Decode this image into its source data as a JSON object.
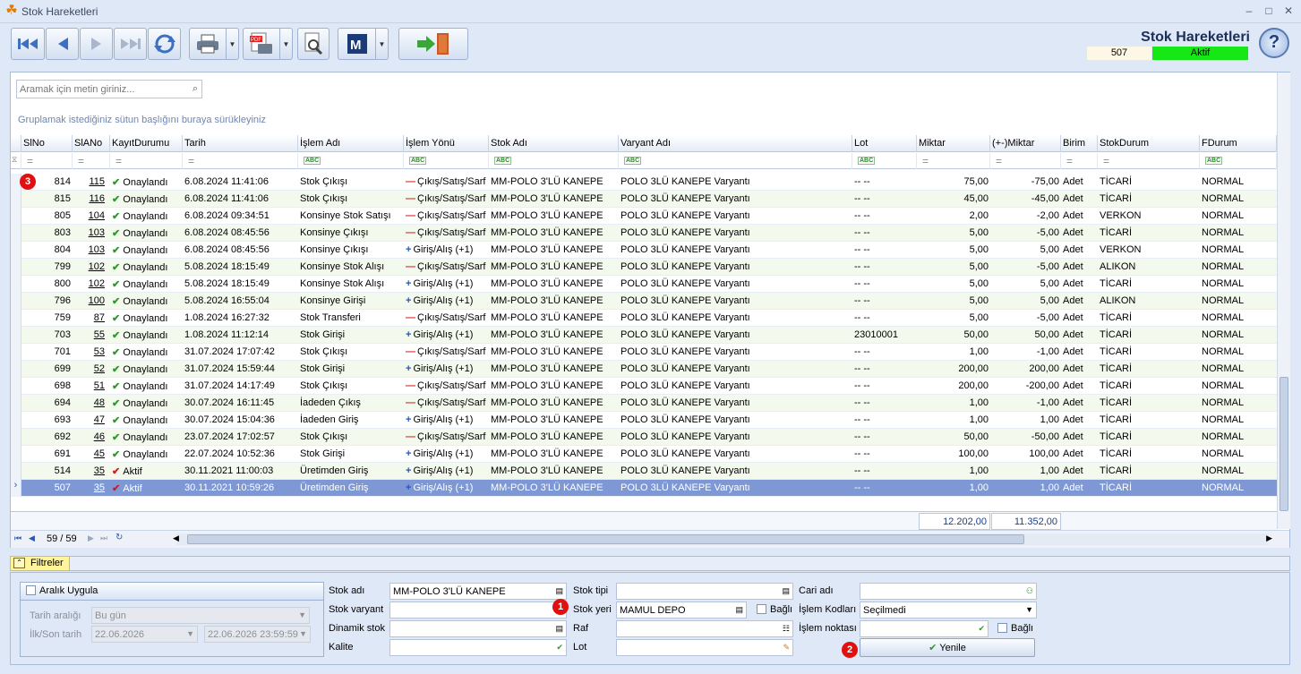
{
  "window": {
    "title": "Stok Hareketleri",
    "min": "–",
    "max": "□",
    "close": "✕"
  },
  "header": {
    "form_title": "Stok Hareketleri",
    "record_no": "507",
    "record_status": "Aktif"
  },
  "help": {
    "label": "?"
  },
  "grid": {
    "search_placeholder": "Aramak için metin giriniz...",
    "group_hint": "Gruplamak istediğiniz sütun başlığını buraya sürükleyiniz",
    "columns": [
      "SlNo",
      "SlANo",
      "KayıtDurumu",
      "Tarih",
      "İşlem Adı",
      "İşlem Yönü",
      "Stok Adı",
      "Varyant Adı",
      "Lot",
      "Miktar",
      "(+-)Miktar",
      "Birim",
      "StokDurum",
      "FDurum"
    ],
    "filter_eq": "=",
    "filter_abc": "ABC",
    "rows": [
      {
        "sl": "814",
        "sla": "115",
        "durum": "Onaylandı",
        "tarih": "6.08.2024 11:41:06",
        "islem": "Stok Çıkışı",
        "yon": "Çıkış/Satış/Sarf",
        "yonType": "minus",
        "stok": "MM-POLO 3'LÜ KANEPE",
        "varyant": "POLO 3LÜ KANEPE Varyantı",
        "lot": "-- --",
        "miktar": "75,00",
        "pm": "-75,00",
        "birim": "Adet",
        "sd": "TİCARİ",
        "fd": "NORMAL",
        "ok": true
      },
      {
        "sl": "815",
        "sla": "116",
        "durum": "Onaylandı",
        "tarih": "6.08.2024 11:41:06",
        "islem": "Stok Çıkışı",
        "yon": "Çıkış/Satış/Sarf",
        "yonType": "minus",
        "stok": "MM-POLO 3'LÜ KANEPE",
        "varyant": "POLO 3LÜ KANEPE Varyantı",
        "lot": "-- --",
        "miktar": "45,00",
        "pm": "-45,00",
        "birim": "Adet",
        "sd": "TİCARİ",
        "fd": "NORMAL",
        "ok": true
      },
      {
        "sl": "805",
        "sla": "104",
        "durum": "Onaylandı",
        "tarih": "6.08.2024 09:34:51",
        "islem": "Konsinye Stok Satışı",
        "yon": "Çıkış/Satış/Sarf",
        "yonType": "minus",
        "stok": "MM-POLO 3'LÜ KANEPE",
        "varyant": "POLO 3LÜ KANEPE Varyantı",
        "lot": "-- --",
        "miktar": "2,00",
        "pm": "-2,00",
        "birim": "Adet",
        "sd": "VERKON",
        "fd": "NORMAL",
        "ok": true
      },
      {
        "sl": "803",
        "sla": "103",
        "durum": "Onaylandı",
        "tarih": "6.08.2024 08:45:56",
        "islem": "Konsinye Çıkışı",
        "yon": "Çıkış/Satış/Sarf",
        "yonType": "minus",
        "stok": "MM-POLO 3'LÜ KANEPE",
        "varyant": "POLO 3LÜ KANEPE Varyantı",
        "lot": "-- --",
        "miktar": "5,00",
        "pm": "-5,00",
        "birim": "Adet",
        "sd": "TİCARİ",
        "fd": "NORMAL",
        "ok": true
      },
      {
        "sl": "804",
        "sla": "103",
        "durum": "Onaylandı",
        "tarih": "6.08.2024 08:45:56",
        "islem": "Konsinye Çıkışı",
        "yon": "Giriş/Alış (+1)",
        "yonType": "plus",
        "stok": "MM-POLO 3'LÜ KANEPE",
        "varyant": "POLO 3LÜ KANEPE Varyantı",
        "lot": "-- --",
        "miktar": "5,00",
        "pm": "5,00",
        "birim": "Adet",
        "sd": "VERKON",
        "fd": "NORMAL",
        "ok": true
      },
      {
        "sl": "799",
        "sla": "102",
        "durum": "Onaylandı",
        "tarih": "5.08.2024 18:15:49",
        "islem": "Konsinye Stok Alışı",
        "yon": "Çıkış/Satış/Sarf",
        "yonType": "minus",
        "stok": "MM-POLO 3'LÜ KANEPE",
        "varyant": "POLO 3LÜ KANEPE Varyantı",
        "lot": "-- --",
        "miktar": "5,00",
        "pm": "-5,00",
        "birim": "Adet",
        "sd": "ALIKON",
        "fd": "NORMAL",
        "ok": true
      },
      {
        "sl": "800",
        "sla": "102",
        "durum": "Onaylandı",
        "tarih": "5.08.2024 18:15:49",
        "islem": "Konsinye Stok Alışı",
        "yon": "Giriş/Alış (+1)",
        "yonType": "plus",
        "stok": "MM-POLO 3'LÜ KANEPE",
        "varyant": "POLO 3LÜ KANEPE Varyantı",
        "lot": "-- --",
        "miktar": "5,00",
        "pm": "5,00",
        "birim": "Adet",
        "sd": "TİCARİ",
        "fd": "NORMAL",
        "ok": true
      },
      {
        "sl": "796",
        "sla": "100",
        "durum": "Onaylandı",
        "tarih": "5.08.2024 16:55:04",
        "islem": "Konsinye Girişi",
        "yon": "Giriş/Alış (+1)",
        "yonType": "plus",
        "stok": "MM-POLO 3'LÜ KANEPE",
        "varyant": "POLO 3LÜ KANEPE Varyantı",
        "lot": "-- --",
        "miktar": "5,00",
        "pm": "5,00",
        "birim": "Adet",
        "sd": "ALIKON",
        "fd": "NORMAL",
        "ok": true
      },
      {
        "sl": "759",
        "sla": "87",
        "durum": "Onaylandı",
        "tarih": "1.08.2024 16:27:32",
        "islem": "Stok Transferi",
        "yon": "Çıkış/Satış/Sarf",
        "yonType": "minus",
        "stok": "MM-POLO 3'LÜ KANEPE",
        "varyant": "POLO 3LÜ KANEPE Varyantı",
        "lot": "-- --",
        "miktar": "5,00",
        "pm": "-5,00",
        "birim": "Adet",
        "sd": "TİCARİ",
        "fd": "NORMAL",
        "ok": true
      },
      {
        "sl": "703",
        "sla": "55",
        "durum": "Onaylandı",
        "tarih": "1.08.2024 11:12:14",
        "islem": "Stok Girişi",
        "yon": "Giriş/Alış (+1)",
        "yonType": "plus",
        "stok": "MM-POLO 3'LÜ KANEPE",
        "varyant": "POLO 3LÜ KANEPE Varyantı",
        "lot": "23010001",
        "miktar": "50,00",
        "pm": "50,00",
        "birim": "Adet",
        "sd": "TİCARİ",
        "fd": "NORMAL",
        "ok": true
      },
      {
        "sl": "701",
        "sla": "53",
        "durum": "Onaylandı",
        "tarih": "31.07.2024 17:07:42",
        "islem": "Stok Çıkışı",
        "yon": "Çıkış/Satış/Sarf",
        "yonType": "minus",
        "stok": "MM-POLO 3'LÜ KANEPE",
        "varyant": "POLO 3LÜ KANEPE Varyantı",
        "lot": "-- --",
        "miktar": "1,00",
        "pm": "-1,00",
        "birim": "Adet",
        "sd": "TİCARİ",
        "fd": "NORMAL",
        "ok": true
      },
      {
        "sl": "699",
        "sla": "52",
        "durum": "Onaylandı",
        "tarih": "31.07.2024 15:59:44",
        "islem": "Stok Girişi",
        "yon": "Giriş/Alış (+1)",
        "yonType": "plus",
        "stok": "MM-POLO 3'LÜ KANEPE",
        "varyant": "POLO 3LÜ KANEPE Varyantı",
        "lot": "-- --",
        "miktar": "200,00",
        "pm": "200,00",
        "birim": "Adet",
        "sd": "TİCARİ",
        "fd": "NORMAL",
        "ok": true
      },
      {
        "sl": "698",
        "sla": "51",
        "durum": "Onaylandı",
        "tarih": "31.07.2024 14:17:49",
        "islem": "Stok Çıkışı",
        "yon": "Çıkış/Satış/Sarf",
        "yonType": "minus",
        "stok": "MM-POLO 3'LÜ KANEPE",
        "varyant": "POLO 3LÜ KANEPE Varyantı",
        "lot": "-- --",
        "miktar": "200,00",
        "pm": "-200,00",
        "birim": "Adet",
        "sd": "TİCARİ",
        "fd": "NORMAL",
        "ok": true
      },
      {
        "sl": "694",
        "sla": "48",
        "durum": "Onaylandı",
        "tarih": "30.07.2024 16:11:45",
        "islem": "İadeden Çıkış",
        "yon": "Çıkış/Satış/Sarf",
        "yonType": "minus",
        "stok": "MM-POLO 3'LÜ KANEPE",
        "varyant": "POLO 3LÜ KANEPE Varyantı",
        "lot": "-- --",
        "miktar": "1,00",
        "pm": "-1,00",
        "birim": "Adet",
        "sd": "TİCARİ",
        "fd": "NORMAL",
        "ok": true
      },
      {
        "sl": "693",
        "sla": "47",
        "durum": "Onaylandı",
        "tarih": "30.07.2024 15:04:36",
        "islem": "İadeden Giriş",
        "yon": "Giriş/Alış (+1)",
        "yonType": "plus",
        "stok": "MM-POLO 3'LÜ KANEPE",
        "varyant": "POLO 3LÜ KANEPE Varyantı",
        "lot": "-- --",
        "miktar": "1,00",
        "pm": "1,00",
        "birim": "Adet",
        "sd": "TİCARİ",
        "fd": "NORMAL",
        "ok": true
      },
      {
        "sl": "692",
        "sla": "46",
        "durum": "Onaylandı",
        "tarih": "23.07.2024 17:02:57",
        "islem": "Stok Çıkışı",
        "yon": "Çıkış/Satış/Sarf",
        "yonType": "minus",
        "stok": "MM-POLO 3'LÜ KANEPE",
        "varyant": "POLO 3LÜ KANEPE Varyantı",
        "lot": "-- --",
        "miktar": "50,00",
        "pm": "-50,00",
        "birim": "Adet",
        "sd": "TİCARİ",
        "fd": "NORMAL",
        "ok": true
      },
      {
        "sl": "691",
        "sla": "45",
        "durum": "Onaylandı",
        "tarih": "22.07.2024 10:52:36",
        "islem": "Stok Girişi",
        "yon": "Giriş/Alış (+1)",
        "yonType": "plus",
        "stok": "MM-POLO 3'LÜ KANEPE",
        "varyant": "POLO 3LÜ KANEPE Varyantı",
        "lot": "-- --",
        "miktar": "100,00",
        "pm": "100,00",
        "birim": "Adet",
        "sd": "TİCARİ",
        "fd": "NORMAL",
        "ok": true
      },
      {
        "sl": "514",
        "sla": "35",
        "durum": "Aktif",
        "tarih": "30.11.2021 11:00:03",
        "islem": "Üretimden Giriş",
        "yon": "Giriş/Alış (+1)",
        "yonType": "plus",
        "stok": "MM-POLO 3'LÜ KANEPE",
        "varyant": "POLO 3LÜ KANEPE Varyantı",
        "lot": "-- --",
        "miktar": "1,00",
        "pm": "1,00",
        "birim": "Adet",
        "sd": "TİCARİ",
        "fd": "NORMAL",
        "ok": false
      },
      {
        "sl": "507",
        "sla": "35",
        "durum": "Aktif",
        "tarih": "30.11.2021 10:59:26",
        "islem": "Üretimden Giriş",
        "yon": "Giriş/Alış (+1)",
        "yonType": "plus",
        "stok": "MM-POLO 3'LÜ KANEPE",
        "varyant": "POLO 3LÜ KANEPE Varyantı",
        "lot": "-- --",
        "miktar": "1,00",
        "pm": "1,00",
        "birim": "Adet",
        "sd": "TİCARİ",
        "fd": "NORMAL",
        "ok": false,
        "selected": true
      }
    ],
    "sum_miktar": "12.202,00",
    "sum_pm": "11.352,00",
    "pager": "59 / 59"
  },
  "badges": {
    "b1": "1",
    "b2": "2",
    "b3": "3"
  },
  "filters": {
    "tab_label": "Filtreler",
    "aralik": {
      "label": "Aralık Uygula",
      "range_label": "Tarih aralığı",
      "range_value": "Bu gün",
      "first_last_label": "İlk/Son tarih",
      "start": "22.06.2026",
      "end": "22.06.2026 23:59:59"
    },
    "stok_adi": {
      "label": "Stok adı",
      "value": "MM-POLO 3'LÜ KANEPE"
    },
    "stok_varyant": {
      "label": "Stok varyant",
      "value": ""
    },
    "dinamik_stok": {
      "label": "Dinamik stok",
      "value": ""
    },
    "kalite": {
      "label": "Kalite",
      "value": ""
    },
    "stok_tipi": {
      "label": "Stok tipi",
      "value": ""
    },
    "stok_yeri": {
      "label": "Stok yeri",
      "value": "MAMUL DEPO"
    },
    "bagli": "Bağlı",
    "raf": {
      "label": "Raf",
      "value": ""
    },
    "lot": {
      "label": "Lot",
      "value": ""
    },
    "cari_adi": {
      "label": "Cari adı",
      "value": ""
    },
    "islem_kodlari": {
      "label": "İşlem Kodları",
      "value": "Seçilmedi"
    },
    "islem_noktasi": {
      "label": "İşlem noktası",
      "value": ""
    },
    "yenile": "Yenile"
  }
}
